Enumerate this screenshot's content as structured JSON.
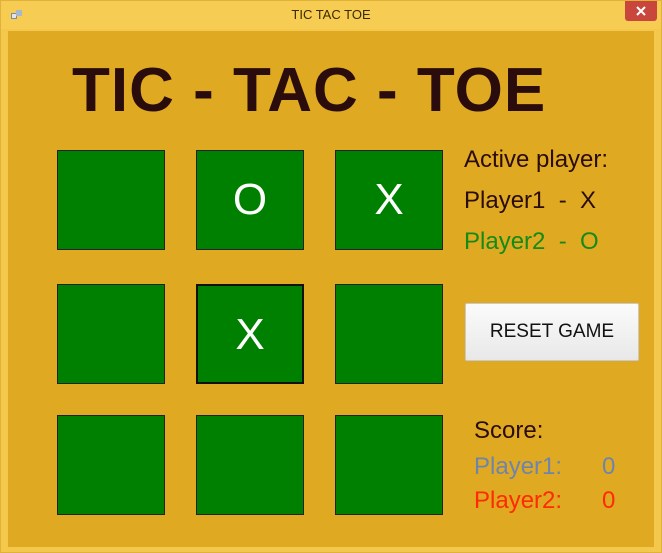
{
  "window": {
    "title": "TIC TAC TOE",
    "close_color": "#c9463d"
  },
  "game": {
    "title": "TIC - TAC - TOE",
    "board": [
      [
        "",
        "O",
        "X"
      ],
      [
        "",
        "X",
        ""
      ],
      [
        "",
        "",
        ""
      ]
    ],
    "cell_color": "#008000"
  },
  "status": {
    "active_label": "Active player:",
    "player1_line": "Player1  -  X",
    "player2_line": "Player2  -  O"
  },
  "controls": {
    "reset_label": "RESET GAME"
  },
  "score": {
    "label": "Score:",
    "player1": {
      "name": "Player1:",
      "value": "0",
      "color": "#6f84ad"
    },
    "player2": {
      "name": "Player2:",
      "value": "0",
      "color": "#ff2a00"
    }
  }
}
